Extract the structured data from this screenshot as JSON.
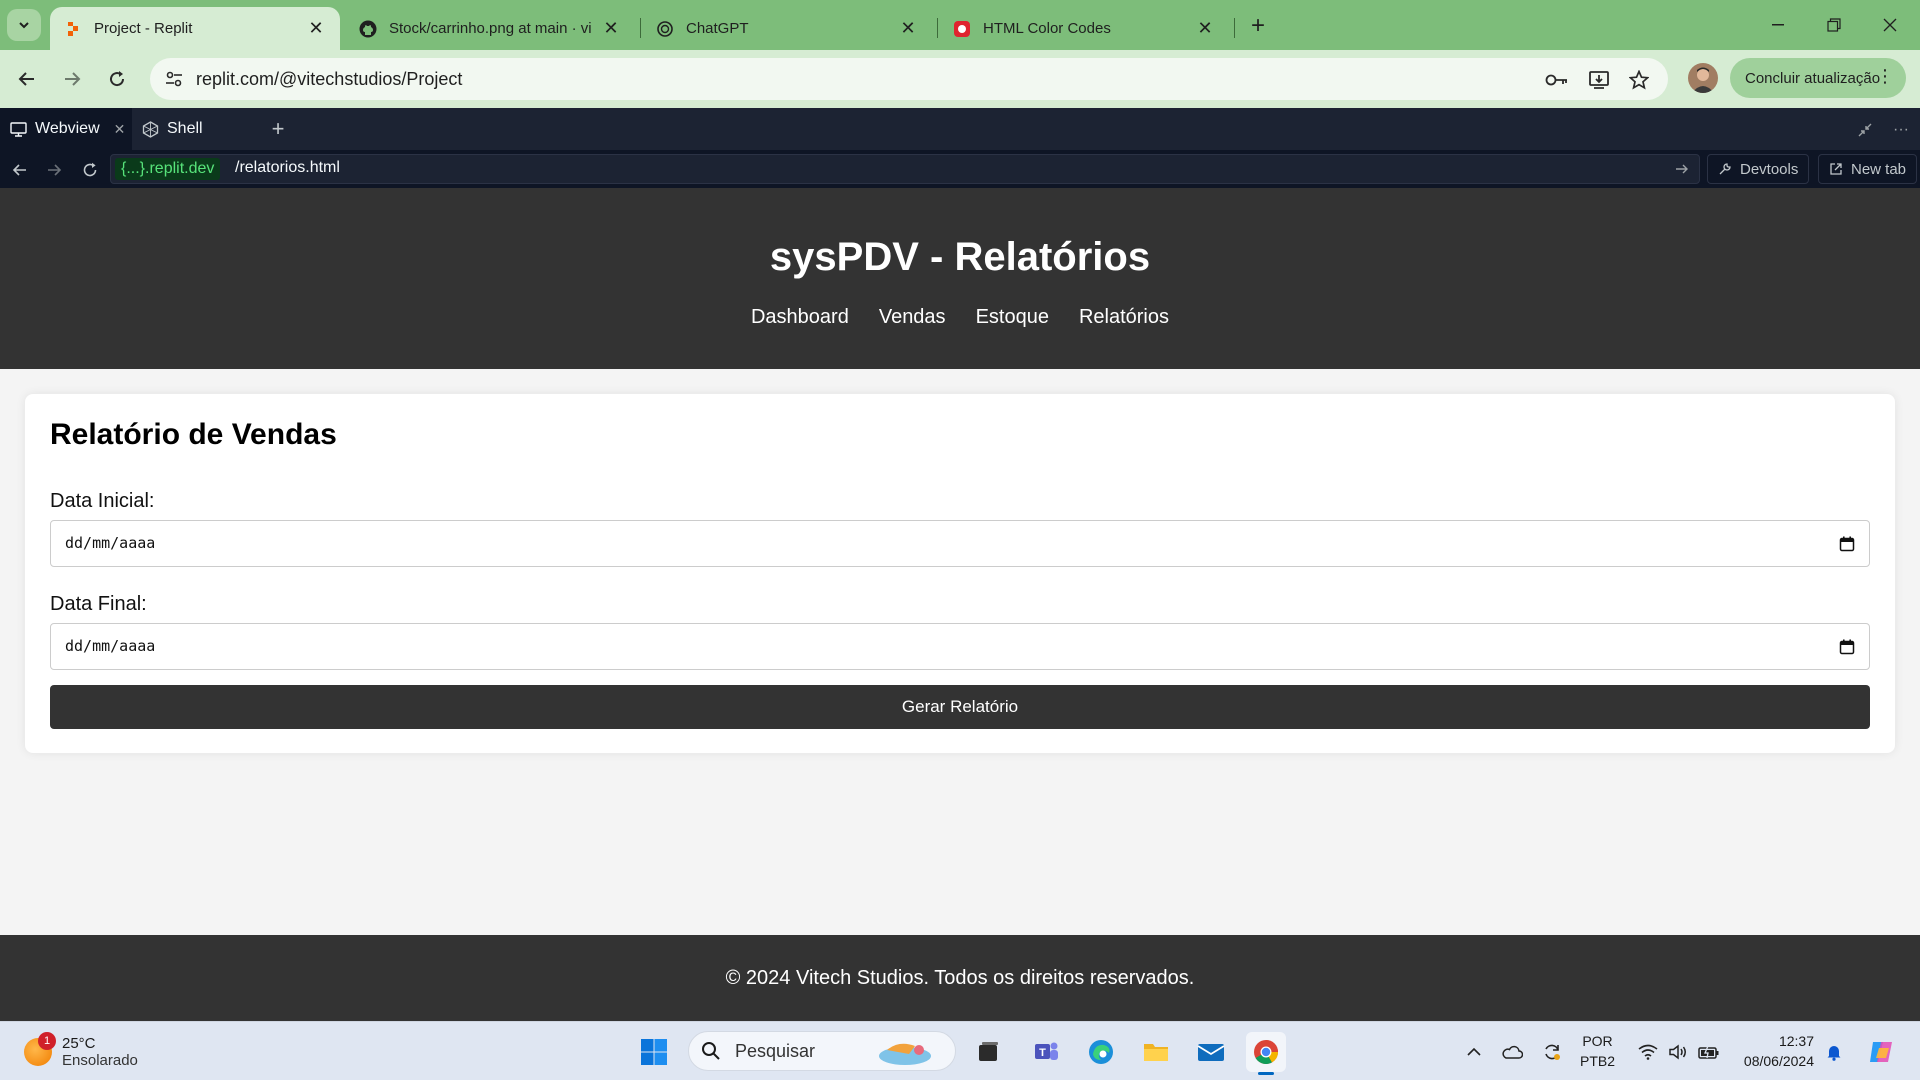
{
  "browser": {
    "tabs": [
      {
        "title": "Project - Replit",
        "active": true
      },
      {
        "title": "Stock/carrinho.png at main · vi",
        "active": false
      },
      {
        "title": "ChatGPT",
        "active": false
      },
      {
        "title": "HTML Color Codes",
        "active": false
      }
    ],
    "url": "replit.com/@vitechstudios/Project",
    "update_label": "Concluir atualização"
  },
  "replit": {
    "tabs": [
      {
        "label": "Webview",
        "active": true
      },
      {
        "label": "Shell",
        "active": false
      }
    ],
    "domain": "{...}.replit.dev",
    "path": "/relatorios.html",
    "devtools_label": "Devtools",
    "newtab_label": "New tab"
  },
  "site": {
    "title": "sysPDV - Relatórios",
    "nav": [
      "Dashboard",
      "Vendas",
      "Estoque",
      "Relatórios"
    ],
    "report": {
      "heading": "Relatório de Vendas",
      "start_label": "Data Inicial:",
      "start_placeholder": "dd/mm/aaaa",
      "end_label": "Data Final:",
      "end_placeholder": "dd/mm/aaaa",
      "button": "Gerar Relatório"
    },
    "footer": "© 2024 Vitech Studios. Todos os direitos reservados."
  },
  "taskbar": {
    "weather_temp": "25°C",
    "weather_desc": "Ensolarado",
    "weather_badge": "1",
    "search_placeholder": "Pesquisar",
    "lang_1": "POR",
    "lang_2": "PTB2",
    "time": "12:37",
    "date": "08/06/2024"
  },
  "colors": {
    "chrome_frame": "#7dbd7a",
    "chrome_toolbar": "#d6ecd3",
    "replit_bg": "#0e1525",
    "site_dark": "#333333"
  }
}
